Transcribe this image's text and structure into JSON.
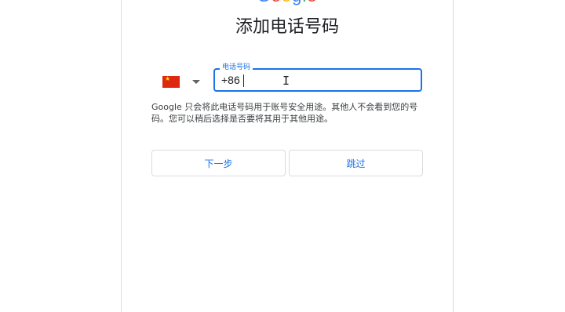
{
  "logo": {
    "text": "Google",
    "colors": [
      "#4285f4",
      "#ea4335",
      "#fbbc05",
      "#4285f4",
      "#34a853",
      "#ea4335"
    ]
  },
  "page": {
    "title": "添加电话号码"
  },
  "country_selector": {
    "flag_icon": "china-flag-icon",
    "dropdown_icon": "chevron-down-icon"
  },
  "phone_field": {
    "label": "电话号码",
    "value": "+86"
  },
  "notice": {
    "text": "Google 只会将此电话号码用于账号安全用途。其他人不会看到您的号码。您可以稍后选择是否要将其用于其他用途。"
  },
  "buttons": {
    "next": "下一步",
    "skip": "跳过"
  },
  "colors": {
    "accent": "#1a73e8",
    "border": "#dadce0",
    "flag_red": "#de2910",
    "flag_yellow": "#ffde00"
  }
}
